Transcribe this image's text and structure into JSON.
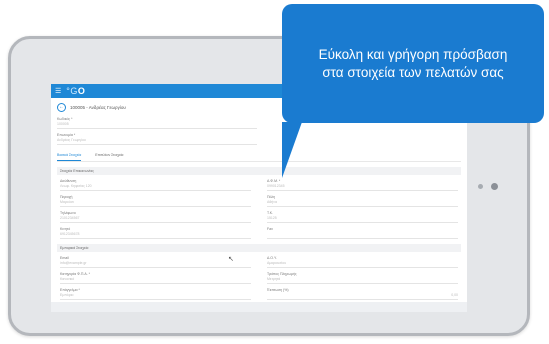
{
  "app": {
    "logo_g": "°G",
    "logo_o": "O",
    "menu_icon": "menu-icon"
  },
  "page": {
    "title": "100005 - Ανδρέας Γεωργίου"
  },
  "top_fields": [
    {
      "label": "Κωδικός *",
      "value": "100005"
    },
    {
      "label": "Επωνυμία *",
      "value": "Ανδρέας Γεωργίου"
    }
  ],
  "tabs": [
    {
      "label": "Βασικά Στοιχεία",
      "active": true
    },
    {
      "label": "Επιπλέον Στοιχεία",
      "active": false
    }
  ],
  "sections": [
    {
      "header": "Στοιχεία Επικοινωνίας",
      "fields": [
        {
          "label": "Διεύθυνση",
          "value": "Λεωφ. Κηφισίας 120"
        },
        {
          "label": "Α.Φ.Μ. *",
          "value": "099012345"
        },
        {
          "label": "Περιοχή",
          "value": "Μαρούσι"
        },
        {
          "label": "Πόλη",
          "value": "Αθήνα"
        },
        {
          "label": "Τηλέφωνο",
          "value": "2101234567"
        },
        {
          "label": "Τ.Κ.",
          "value": "15125"
        },
        {
          "label": "Κινητό",
          "value": "6912345678"
        },
        {
          "label": "Fax",
          "value": ""
        }
      ]
    },
    {
      "header": "Εμπορικά Στοιχεία",
      "fields": [
        {
          "label": "Email",
          "value": "info@example.gr"
        },
        {
          "label": "Δ.Ο.Υ.",
          "value": "Αμαρουσίου"
        },
        {
          "label": "Κατηγορία Φ.Π.Α. *",
          "value": "Κανονικό"
        },
        {
          "label": "Τρόπος Πληρωμής",
          "value": "Μετρητά"
        },
        {
          "label": "Επάγγελμα *",
          "value": "Εμπόριο"
        },
        {
          "label": "Έκπτωση (%)",
          "value": "0,00"
        }
      ]
    }
  ],
  "footer_note": "Σημειώσεις",
  "callout": {
    "line1": "Εύκολη και γρήγορη πρόσβαση",
    "line2": "στα στοιχεία των πελατών σας"
  }
}
